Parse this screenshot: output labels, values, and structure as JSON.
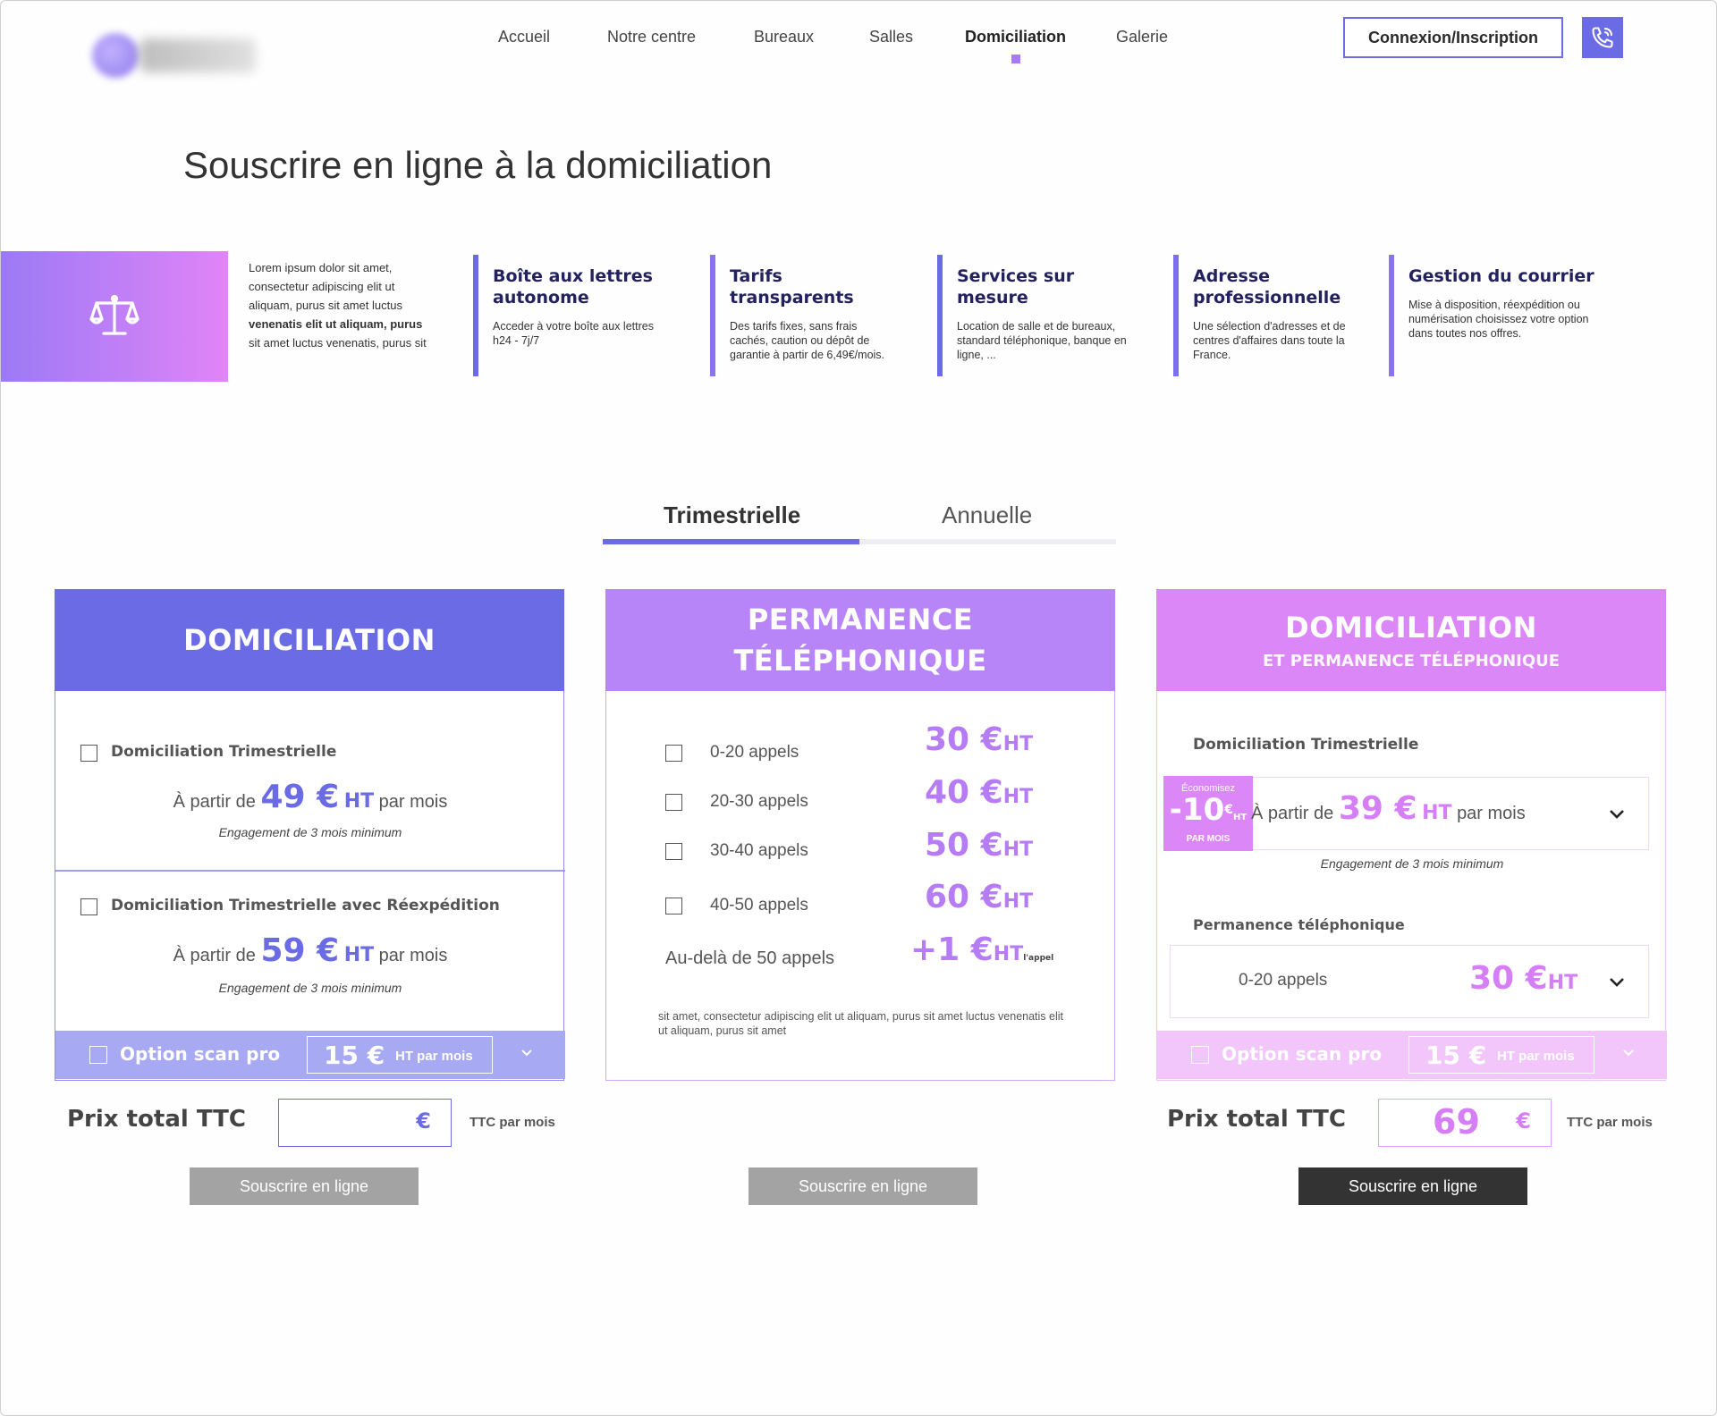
{
  "nav": {
    "items": [
      "Accueil",
      "Notre centre",
      "Bureaux",
      "Salles",
      "Domiciliation",
      "Galerie"
    ],
    "login": "Connexion/Inscription"
  },
  "page": {
    "title": "Souscrire en ligne à la domiciliation"
  },
  "intro": {
    "text_a": "Lorem ipsum dolor sit amet, consectetur adipiscing elit ut aliquam, purus sit amet luctus",
    "text_b": "venenatis elit ut aliquam, purus",
    "text_c": "sit amet luctus venenatis, purus sit"
  },
  "features": [
    {
      "title": "Boîte aux lettres autonome",
      "text": "Acceder à votre boîte aux lettres h24 - 7j/7"
    },
    {
      "title": "Tarifs transparents",
      "text": "Des tarifs fixes, sans frais cachés, caution ou dépôt de garantie à partir de 6,49€/mois."
    },
    {
      "title": "Services sur mesure",
      "text": "Location de salle et de bureaux, standard téléphonique, banque en ligne, ..."
    },
    {
      "title": "Adresse professionnelle",
      "text": "Une sélection d'adresses et de centres d'affaires dans toute la France."
    },
    {
      "title": "Gestion du courrier",
      "text": "Mise à disposition, réexpédition ou numérisation choisissez votre option dans toutes nos offres."
    }
  ],
  "tabs": {
    "active": "Trimestrielle",
    "inactive": "Annuelle"
  },
  "card1": {
    "title": "DOMICILIATION",
    "opt1": {
      "label": "Domiciliation Trimestrielle",
      "from": "À partir de",
      "price": "49 €",
      "ht": "HT",
      "per": "par mois",
      "engage": "Engagement de 3 mois minimum"
    },
    "opt2": {
      "label": "Domiciliation Trimestrielle avec Réexpédition",
      "from": "À partir de",
      "price": "59 €",
      "ht": "HT",
      "per": "par mois",
      "engage": "Engagement de 3 mois minimum"
    },
    "scan": {
      "label": "Option scan pro",
      "value": "15 €",
      "unit": "HT par mois"
    },
    "total": {
      "label": "Prix total TTC",
      "value": "",
      "euro": "€",
      "ttc": "TTC par mois"
    },
    "cta": "Souscrire en ligne"
  },
  "card2": {
    "title_l1": "PERMANENCE",
    "title_l2": "TÉLÉPHONIQUE",
    "rows": [
      {
        "label": "0-20 appels",
        "price": "30 €",
        "ht": "HT"
      },
      {
        "label": "20-30 appels",
        "price": "40 €",
        "ht": "HT"
      },
      {
        "label": "30-40 appels",
        "price": "50 €",
        "ht": "HT"
      },
      {
        "label": "40-50 appels",
        "price": "60 €",
        "ht": "HT"
      }
    ],
    "beyond": {
      "label": "Au-delà de 50 appels",
      "price": "+1 €",
      "ht": "HT",
      "suffix": "l'appel"
    },
    "note": "sit amet, consectetur adipiscing elit ut aliquam, purus sit amet luctus venenatis elit ut aliquam, purus sit amet",
    "cta": "Souscrire en ligne"
  },
  "card3": {
    "title": "DOMICILIATION",
    "subtitle": "ET PERMANENCE TÉLÉPHONIQUE",
    "dom": {
      "label": "Domiciliation Trimestrielle",
      "from": "À partir de",
      "price": "39 €",
      "ht": "HT",
      "per": "par mois",
      "engage": "Engagement de 3 mois minimum"
    },
    "badge": {
      "line1": "Économisez",
      "value": "-10",
      "cur": "€",
      "ht": "HT",
      "line3": "PAR MOIS"
    },
    "perm": {
      "label": "Permanence téléphonique",
      "selected": "0-20 appels",
      "price": "30 €",
      "ht": "HT"
    },
    "scan": {
      "label": "Option scan pro",
      "value": "15 €",
      "unit": "HT par mois"
    },
    "total": {
      "label": "Prix total TTC",
      "value": "69",
      "euro": "€",
      "ttc": "TTC par mois"
    },
    "cta": "Souscrire en ligne"
  },
  "colors": {
    "blue": "#6b6be6",
    "violet": "#b785f8",
    "pink": "#dc87f7",
    "cta_disabled": "#a3a3a3",
    "cta_active": "#333333"
  }
}
